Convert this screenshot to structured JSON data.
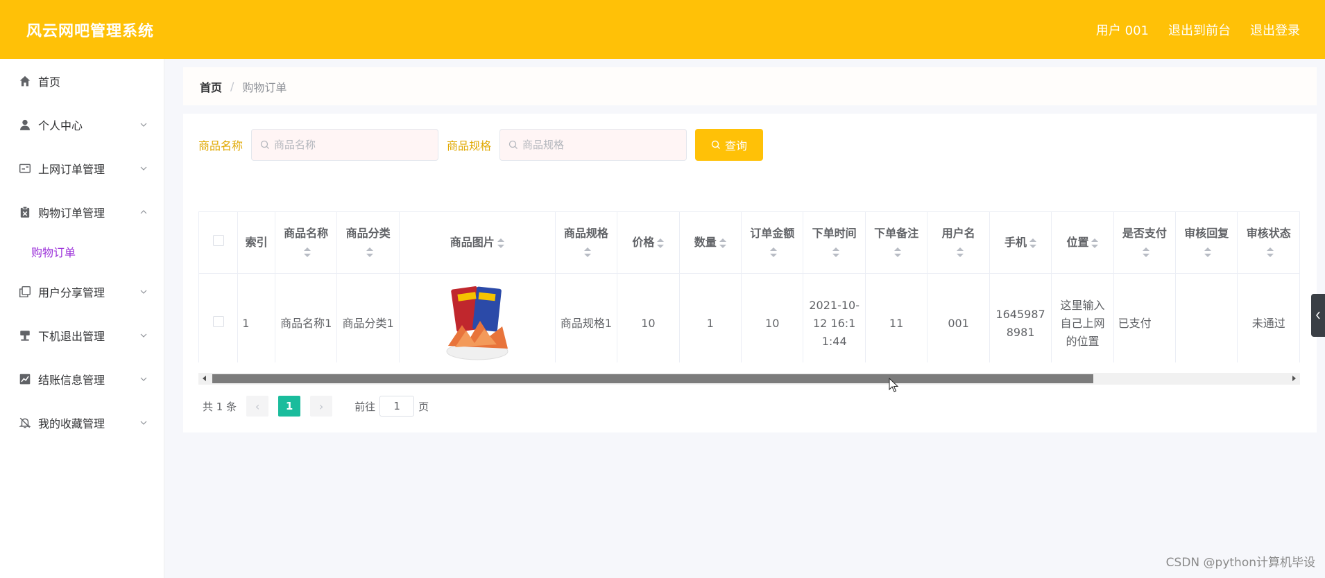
{
  "header": {
    "app_title": "风云网吧管理系统",
    "user_label": "用户 001",
    "back_front": "退出到前台",
    "logout": "退出登录"
  },
  "sidebar": {
    "items": [
      {
        "label": "首页",
        "icon": "home-icon"
      },
      {
        "label": "个人中心",
        "icon": "user-icon"
      },
      {
        "label": "上网订单管理",
        "icon": "card-icon"
      },
      {
        "label": "购物订单管理",
        "icon": "clipboard-icon"
      },
      {
        "label": "用户分享管理",
        "icon": "copy-icon"
      },
      {
        "label": "下机退出管理",
        "icon": "stamp-icon"
      },
      {
        "label": "结账信息管理",
        "icon": "chart-icon"
      },
      {
        "label": "我的收藏管理",
        "icon": "bell-off-icon"
      }
    ],
    "sub_item": "购物订单"
  },
  "breadcrumb": {
    "home": "首页",
    "sep": "/",
    "current": "购物订单"
  },
  "search": {
    "name_label": "商品名称",
    "name_placeholder": "商品名称",
    "spec_label": "商品规格",
    "spec_placeholder": "商品规格",
    "query_label": "查询"
  },
  "table": {
    "headers": [
      "索引",
      "商品名称",
      "商品分类",
      "商品图片",
      "商品规格",
      "价格",
      "数量",
      "订单金额",
      "下单时间",
      "下单备注",
      "用户名",
      "手机",
      "位置",
      "是否支付",
      "审核回复",
      "审核状态"
    ],
    "rows": [
      {
        "index": "1",
        "name": "商品名称1",
        "category": "商品分类1",
        "spec": "商品规格1",
        "price": "10",
        "qty": "1",
        "amount": "10",
        "time": "2021-10-12 16:11:44",
        "note": "11",
        "username": "001",
        "phone": "16459878981",
        "location": "这里输入自己上网的位置",
        "paid": "已支付",
        "reply": "",
        "status": "未通过"
      }
    ]
  },
  "pagination": {
    "total": "共 1 条",
    "current": "1",
    "goto_prefix": "前往",
    "goto_value": "1",
    "goto_suffix": "页"
  },
  "watermark": "CSDN @python计算机毕设",
  "colors": {
    "accent": "#ffc107",
    "active_sub": "#9b30d9",
    "page_active": "#1abc9c"
  }
}
